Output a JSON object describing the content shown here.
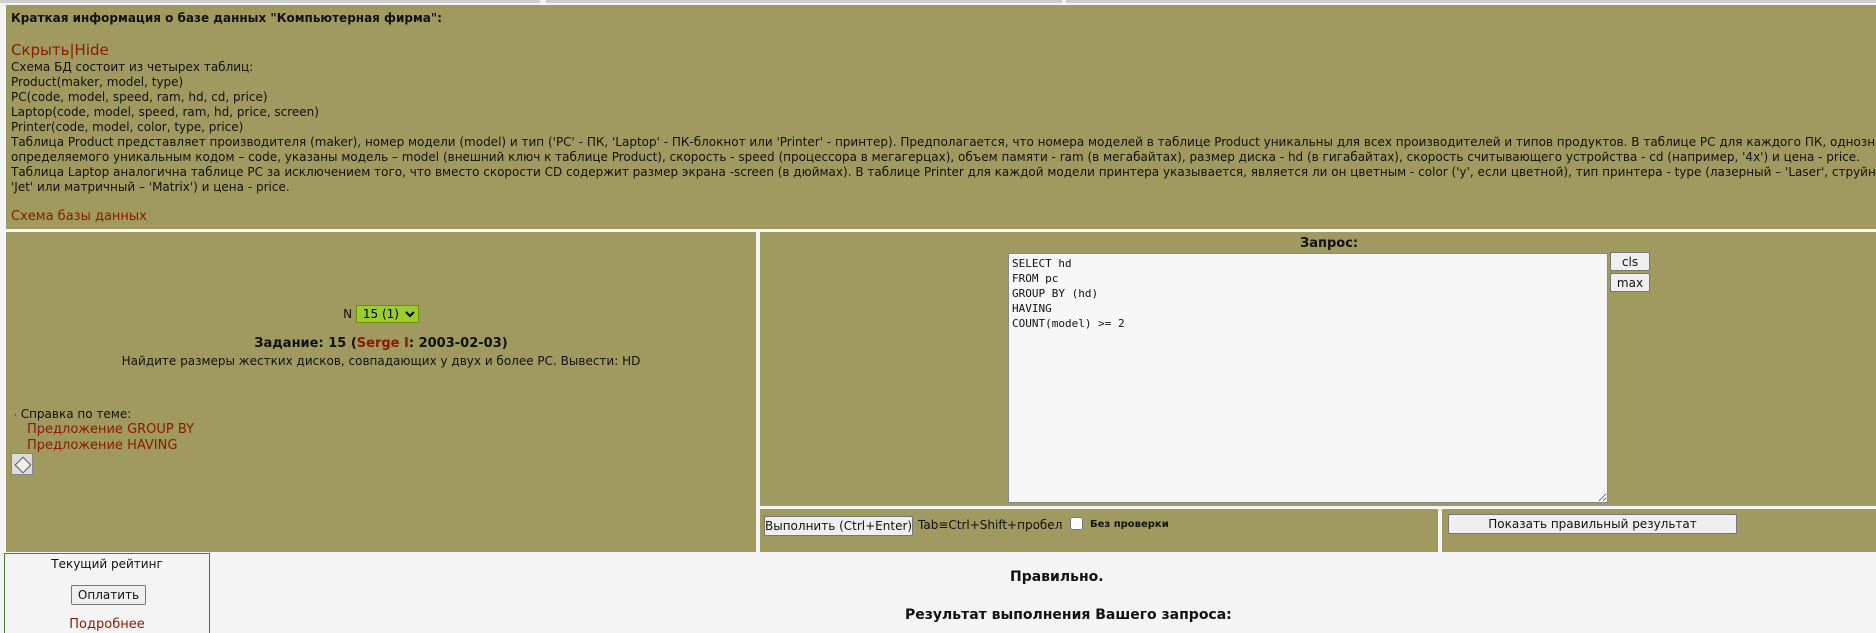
{
  "info": {
    "title": "Краткая информация о базе данных \"Компьютерная фирма\":",
    "hide_ru": "Скрыть",
    "hide_sep": "|",
    "hide_en": "Hide",
    "lines": [
      "Схема БД состоит из четырех таблиц:",
      "Product(maker, model, type)",
      "PC(code, model, speed, ram, hd, cd, price)",
      "Laptop(code, model, speed, ram, hd, price, screen)",
      "Printer(code, model, color, type, price)",
      "Таблица Product представляет производителя (maker), номер модели (model) и тип ('PC' - ПК, 'Laptop' - ПК-блокнот или 'Printer' - принтер). Предполагается, что номера моделей в таблице Product уникальны для всех производителей и типов продуктов. В таблице PC для каждого ПК, однозначно",
      "определяемого уникальным кодом – code, указаны модель – model (внешний ключ к таблице Product), скорость - speed (процессора в мегагерцах), объем памяти - ram (в мегабайтах), размер диска - hd (в гигабайтах), скорость считывающего устройства - cd (например, '4x') и цена - price.",
      "Таблица Laptop аналогична таблице PC за исключением того, что вместо скорости CD содержит размер экрана -screen (в дюймах). В таблице Printer для каждой модели принтера указывается, является ли он цветным - color ('y', если цветной), тип принтера - type (лазерный – 'Laser', струйный –",
      "'Jet' или матричный – 'Matrix') и цена - price."
    ],
    "schema_link": "Схема базы данных"
  },
  "task": {
    "n_label": "N",
    "n_selected": "15 (1)",
    "title_prefix": "Задание: 15 (",
    "author": "Serge I",
    "title_suffix": ": 2003-02-03)",
    "description": "Найдите размеры жестких дисков, совпадающих у двух и более PC. Вывести: HD",
    "help_label": "Справка по теме:",
    "help_bullet": "·",
    "help_links": [
      "Предложение GROUP BY",
      "Предложение HAVING"
    ]
  },
  "query": {
    "label": "Запрос:",
    "text": "SELECT hd\nFROM pc\nGROUP BY (hd)\nHAVING\nCOUNT(model) >= 2",
    "cls_label": "cls",
    "max_label": "max",
    "execute_label": "Выполнить (Ctrl+Enter)",
    "tab_hint": "Tab≡Ctrl+Shift+пробел",
    "no_check_label": "Без  проверки",
    "show_correct_label": "Показать правильный результат"
  },
  "rating": {
    "title": "Текущий рейтинг",
    "pay_label": "Оплатить",
    "more_link": "Подробнее"
  },
  "result": {
    "status": "Правильно.",
    "title": "Результат выполнения Вашего запроса:"
  },
  "colors": {
    "panel": "#a09a60",
    "link": "#8a1a00",
    "select_bg": "#9acd32"
  }
}
